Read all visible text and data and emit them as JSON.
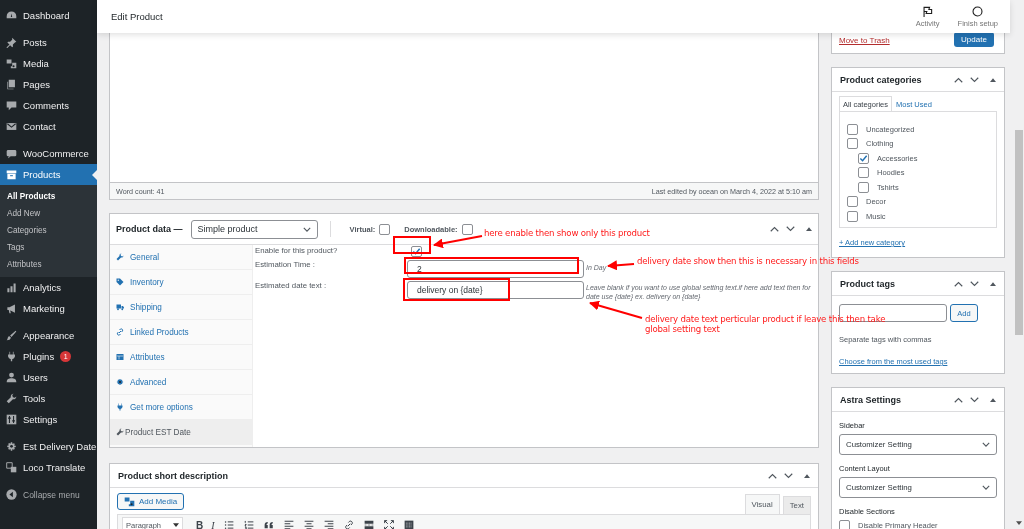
{
  "sidebar": {
    "groups": [
      [
        {
          "label": "Dashboard",
          "selected": false
        }
      ],
      [
        {
          "label": "Posts",
          "selected": false
        },
        {
          "label": "Media",
          "selected": false
        },
        {
          "label": "Pages",
          "selected": false
        },
        {
          "label": "Comments",
          "selected": false
        },
        {
          "label": "Contact",
          "selected": false
        }
      ],
      [
        {
          "label": "WooCommerce",
          "selected": false
        },
        {
          "label": "Products",
          "selected": true,
          "submenu": [
            {
              "label": "All Products",
              "selected": true
            },
            {
              "label": "Add New",
              "selected": false
            },
            {
              "label": "Categories",
              "selected": false
            },
            {
              "label": "Tags",
              "selected": false
            },
            {
              "label": "Attributes",
              "selected": false
            }
          ]
        },
        {
          "label": "Analytics",
          "selected": false
        },
        {
          "label": "Marketing",
          "selected": false
        }
      ],
      [
        {
          "label": "Appearance",
          "selected": false
        },
        {
          "label": "Plugins",
          "selected": false,
          "badge": "1"
        },
        {
          "label": "Users",
          "selected": false
        },
        {
          "label": "Tools",
          "selected": false
        },
        {
          "label": "Settings",
          "selected": false
        }
      ],
      [
        {
          "label": "Est Delivery Date",
          "selected": false
        },
        {
          "label": "Loco Translate",
          "selected": false
        }
      ]
    ],
    "collapse": "Collapse menu"
  },
  "header": {
    "title": "Edit Product",
    "actions": [
      {
        "label": "Activity"
      },
      {
        "label": "Finish setup"
      }
    ]
  },
  "editor": {
    "word_count": "Word count: 41",
    "last_edited": "Last edited by ocean on March 4, 2022 at 5:10 am"
  },
  "product_data": {
    "title": "Product data —",
    "product_type": "Simple product",
    "options": [
      {
        "label": "Virtual:",
        "checked": false
      },
      {
        "label": "Downloadable:",
        "checked": false
      }
    ],
    "tabs": [
      {
        "label": "General",
        "selected": false
      },
      {
        "label": "Inventory",
        "selected": false
      },
      {
        "label": "Shipping",
        "selected": false
      },
      {
        "label": "Linked Products",
        "selected": false
      },
      {
        "label": "Attributes",
        "selected": false
      },
      {
        "label": "Advanced",
        "selected": false
      },
      {
        "label": "Get more options",
        "selected": false
      },
      {
        "label": "Product EST Date",
        "selected": true
      }
    ],
    "fields": [
      {
        "kind": "checkbox",
        "label": "Enable for this product?",
        "checked": true
      },
      {
        "kind": "text",
        "label": "Estimation Time :",
        "value": "2",
        "hint": "In Day"
      },
      {
        "kind": "text",
        "label": "Estimated date text :",
        "value": "delivery on {date}",
        "hint": "Leave blank if you want to use global setting text.if here add text then for date use {date} ex. delivery on {date}"
      }
    ]
  },
  "annotations": [
    {
      "text": "here enable then show only this product"
    },
    {
      "text": "delivery date show then this is necessary in this fields"
    },
    {
      "text": "delivery date text perticular product if leave this then take global setting text"
    }
  ],
  "short_description": {
    "title": "Product short description",
    "add_media": "Add Media",
    "tabs": [
      {
        "label": "Visual",
        "selected": true
      },
      {
        "label": "Text",
        "selected": false
      }
    ],
    "format": "Paragraph",
    "tools": [
      {
        "kind": "bold",
        "glyph": "B"
      },
      {
        "kind": "italic",
        "glyph": "I"
      },
      {
        "kind": "bullet-list"
      },
      {
        "kind": "numbered-list"
      },
      {
        "kind": "quote"
      },
      {
        "kind": "align-left"
      },
      {
        "kind": "align-center"
      },
      {
        "kind": "align-right"
      },
      {
        "kind": "link"
      },
      {
        "kind": "read-more"
      },
      {
        "kind": "fullscreen"
      },
      {
        "kind": "toolbar-toggle"
      }
    ]
  },
  "publish": {
    "trash": "Move to Trash",
    "update": "Update"
  },
  "categories": {
    "title": "Product categories",
    "tabs": [
      {
        "label": "All categories",
        "selected": true
      },
      {
        "label": "Most Used",
        "selected": false
      }
    ],
    "items": [
      {
        "label": "Uncategorized",
        "checked": false
      },
      {
        "label": "Clothing",
        "checked": false,
        "children": [
          {
            "label": "Accessories",
            "checked": true
          },
          {
            "label": "Hoodies",
            "checked": false
          },
          {
            "label": "Tshirts",
            "checked": false
          }
        ]
      },
      {
        "label": "Decor",
        "checked": false
      },
      {
        "label": "Music",
        "checked": false
      }
    ],
    "add_link": "+ Add new category"
  },
  "tags": {
    "title": "Product tags",
    "button": "Add",
    "hint": "Separate tags with commas",
    "link": "Choose from the most used tags"
  },
  "astra": {
    "title": "Astra Settings",
    "selects": [
      {
        "label": "Sidebar",
        "value": "Customizer Setting"
      },
      {
        "label": "Content Layout",
        "value": "Customizer Setting"
      }
    ],
    "section": "Disable Sections",
    "checks": [
      {
        "label": "Disable Primary Header",
        "checked": false
      }
    ]
  }
}
